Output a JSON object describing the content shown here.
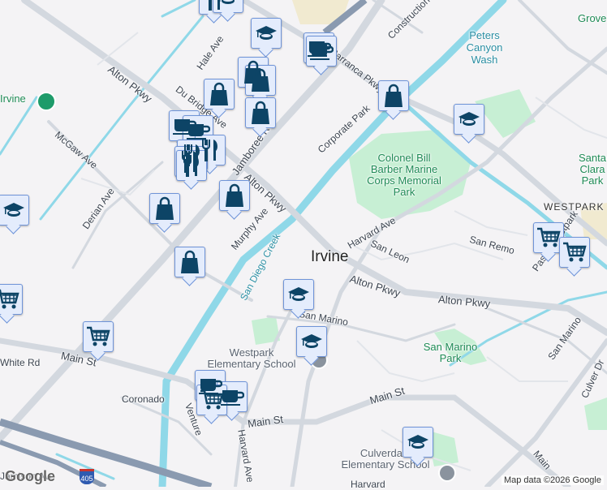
{
  "map": {
    "city_label": "Irvine",
    "roads": [
      "Alton Pkwy",
      "Alton Pkwy",
      "Alton Pkwy",
      "Alton Pkwy",
      "Jamboree Rd",
      "Barranca Pkwy",
      "McGaw Ave",
      "Derian Ave",
      "Murphy Ave",
      "Hale Ave",
      "Du Bridge Ave",
      "Corporate Park",
      "Harvard Ave",
      "Harvard Ave",
      "San Leon",
      "San Remo",
      "San Marino",
      "San Marino",
      "Main St",
      "Main St",
      "Main St",
      "Coronado",
      "Culver Dr",
      "Construction",
      "Paseo Westpark",
      "Venture",
      "White Rd",
      "Jamison Ave",
      "Main",
      "Harvard"
    ],
    "water": [
      "San Diego Creek",
      "Peters Canyon Wash"
    ],
    "parks": [
      "Colonel Bill Barber Marine Corps Memorial Park",
      "San Marino Park",
      "Grove",
      "Santa Clara Park"
    ],
    "places": [
      "Westpark Elementary School",
      "Culverdale Elementary School",
      "Irvine",
      "WESTPARK"
    ],
    "highway_shield": "405",
    "attribution": "Map data ©2026 Google",
    "logo": "Google"
  },
  "colors": {
    "marker_fill": "#e4ecfc",
    "marker_icon": "#0d4466",
    "water": "#8fd8e8",
    "park": "#c7efd4"
  }
}
